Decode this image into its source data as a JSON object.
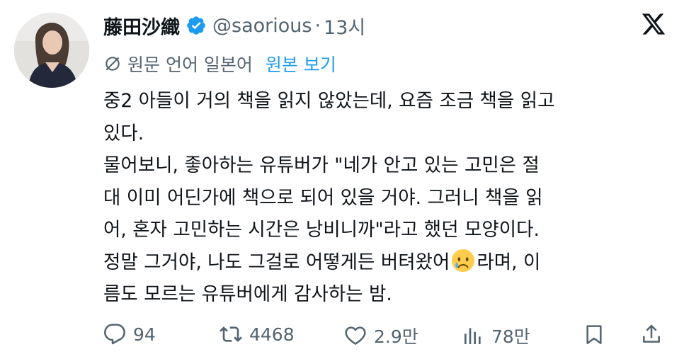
{
  "author": {
    "display_name": "藤田沙織",
    "handle": "@saorious",
    "separator": "·",
    "time": "13시"
  },
  "translation": {
    "info": "원문 언어 일본어",
    "show_original": "원본 보기"
  },
  "post": {
    "lines": [
      "중2 아들이 거의 책을 읽지 않았는데, 요즘 조금 책을 읽고",
      "있다.",
      "물어보니, 좋아하는 유튜버가 \"네가 안고 있는 고민은 절",
      "대 이미 어딘가에 책으로 되어 있을 거야. 그러니 책을 읽",
      "어, 혼자 고민하는 시간은 낭비니까\"라고 했던 모양이다.",
      "정말 그거야, 나도 그걸로 어떻게든 버텨왔어",
      "라며, 이",
      "름도 모르는 유튜버에게 감사하는 밤."
    ]
  },
  "stats": {
    "replies": "94",
    "reposts": "4468",
    "likes": "2.9만",
    "views": "78만"
  },
  "icons": [
    "verified-badge-icon",
    "x-logo-icon",
    "translate-icon",
    "crying-face-emoji",
    "reply-icon",
    "repost-icon",
    "like-icon",
    "views-icon",
    "bookmark-icon",
    "share-icon"
  ],
  "colors": {
    "text": "#0f1419",
    "secondary": "#536471",
    "link": "#1d9bf0"
  }
}
